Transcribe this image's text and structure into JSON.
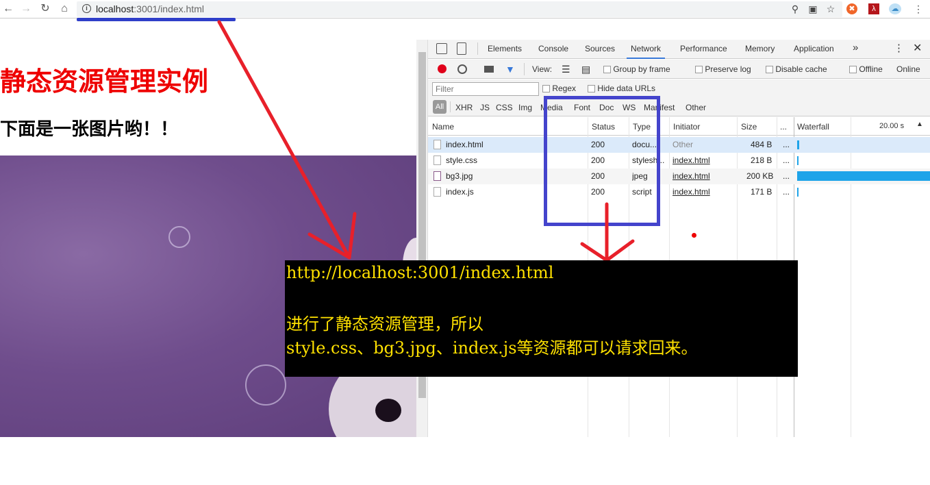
{
  "browser": {
    "url_host": "localhost",
    "url_path": ":3001/index.html"
  },
  "page": {
    "title": "静态资源管理实例",
    "subtitle": "下面是一张图片哟！！"
  },
  "devtools": {
    "tabs": [
      "Elements",
      "Console",
      "Sources",
      "Network",
      "Performance",
      "Memory",
      "Application"
    ],
    "active_tab": "Network",
    "more_tabs": "»",
    "toolbar": {
      "view_label": "View:",
      "group_by_frame": "Group by frame",
      "preserve_log": "Preserve log",
      "disable_cache": "Disable cache",
      "offline": "Offline",
      "online": "Online"
    },
    "filter": {
      "placeholder": "Filter",
      "regex": "Regex",
      "hide_data_urls": "Hide data URLs"
    },
    "types": [
      "All",
      "XHR",
      "JS",
      "CSS",
      "Img",
      "Media",
      "Font",
      "Doc",
      "WS",
      "Manifest",
      "Other"
    ],
    "columns": {
      "name": "Name",
      "status": "Status",
      "type": "Type",
      "initiator": "Initiator",
      "size": "Size",
      "more": "...",
      "waterfall": "Waterfall",
      "waterfall_time": "20.00 s"
    },
    "rows": [
      {
        "name": "index.html",
        "status": "200",
        "type": "docu...",
        "initiator": "Other",
        "size": "484 B",
        "more": "..."
      },
      {
        "name": "style.css",
        "status": "200",
        "type": "stylesh...",
        "initiator": "index.html",
        "size": "218 B",
        "more": "..."
      },
      {
        "name": "bg3.jpg",
        "status": "200",
        "type": "jpeg",
        "initiator": "index.html",
        "size": "200 KB",
        "more": "..."
      },
      {
        "name": "index.js",
        "status": "200",
        "type": "script",
        "initiator": "index.html",
        "size": "171 B",
        "more": "..."
      }
    ]
  },
  "annotation": {
    "line1": "http://localhost:3001/index.html",
    "line2": "进行了静态资源管理，所以",
    "line3": "style.css、bg3.jpg、index.js等资源都可以请求回来。",
    "text_color": "#ffe100",
    "arrow_color": "#e8202a",
    "box_color": "#4444cc"
  }
}
